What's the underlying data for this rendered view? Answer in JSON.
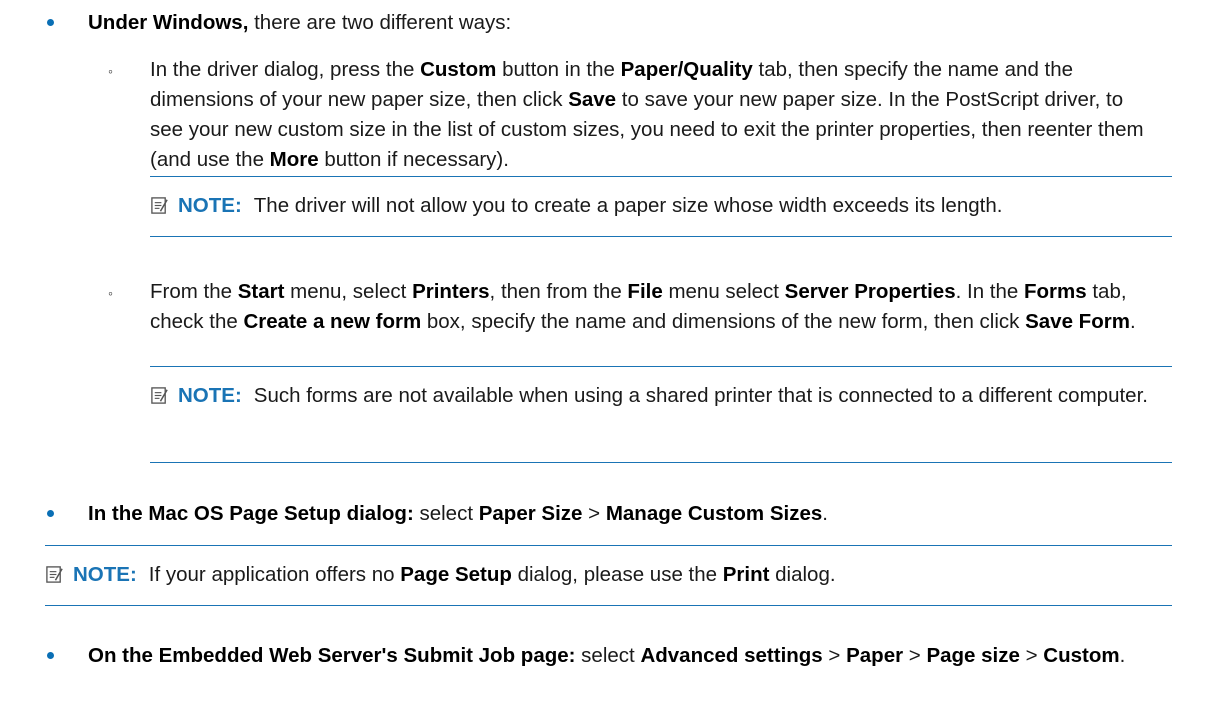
{
  "b1": {
    "bold": "Under Windows,",
    "rest": " there are two different ways:"
  },
  "s1": {
    "t1": "In the driver dialog, press the ",
    "b1": "Custom",
    "t2": " button in the ",
    "b2": "Paper/Quality",
    "t3": " tab, then specify the name and the dimensions of your new paper size, then click ",
    "b3": "Save",
    "t4": " to save your new paper size. In the PostScript driver, to see your new custom size in the list of custom sizes, you need to exit the printer properties, then reenter them (and use the ",
    "b4": "More",
    "t5": " button if necessary)."
  },
  "n1": {
    "label": "NOTE:",
    "text": "The driver will not allow you to create a paper size whose width exceeds its length."
  },
  "s2": {
    "t1": "From the ",
    "b1": "Start",
    "t2": " menu, select ",
    "b2": "Printers",
    "t3": ", then from the ",
    "b3": "File",
    "t4": " menu select ",
    "b4": "Server Properties",
    "t5": ". In the ",
    "b5": "Forms",
    "t6": " tab, check the ",
    "b6": "Create a new form",
    "t7": " box, specify the name and dimensions of the new form, then click ",
    "b7": "Save Form",
    "t8": "."
  },
  "n2": {
    "label": "NOTE:",
    "text": "Such forms are not available when using a shared printer that is connected to a different computer."
  },
  "b2": {
    "bold": "In the Mac OS Page Setup dialog:",
    "t1": " select ",
    "b1": "Paper Size",
    "t2": " > ",
    "b2": "Manage Custom Sizes",
    "t3": "."
  },
  "n3": {
    "label": "NOTE:",
    "t1": "If your application offers no ",
    "b1": "Page Setup",
    "t2": " dialog, please use the ",
    "b2": "Print",
    "t3": " dialog."
  },
  "b3": {
    "bold": "On the Embedded Web Server's Submit Job page:",
    "t1": " select ",
    "b1": "Advanced settings",
    "t2": " > ",
    "b2": "Paper",
    "t3": " > ",
    "b3": "Page size",
    "t4": " > ",
    "b4": "Custom",
    "t5": "."
  }
}
